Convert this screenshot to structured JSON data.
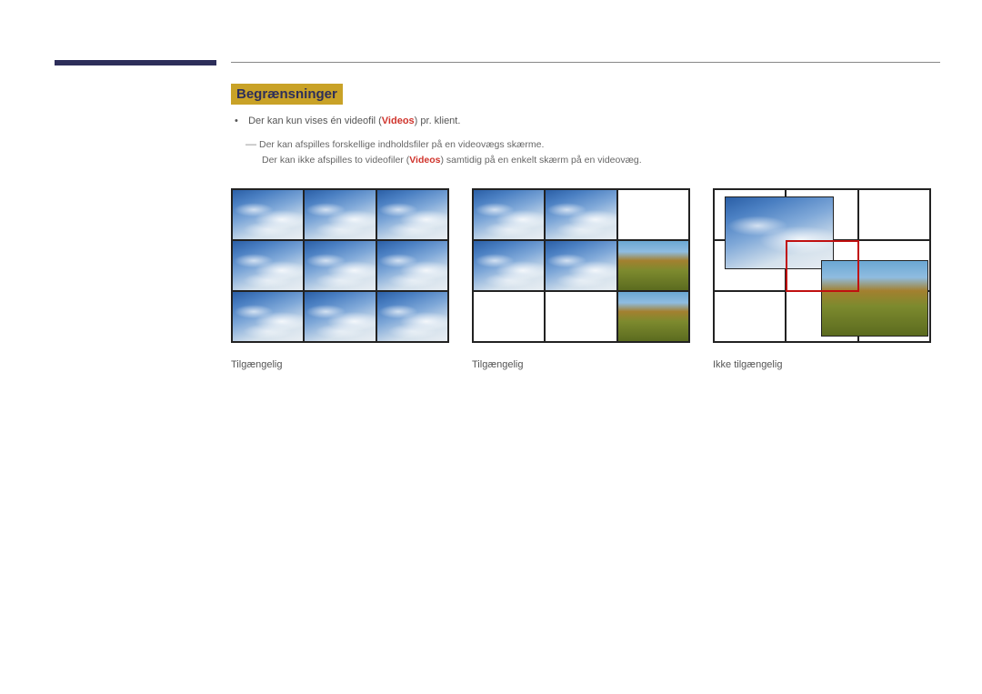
{
  "section_heading": "Begrænsninger",
  "bullet": {
    "text_before": "Der kan kun vises én videofil (",
    "videos_word": "Videos",
    "text_after": ") pr. klient."
  },
  "sublines": {
    "line1": "Der kan afspilles forskellige indholdsfiler på en videovægs skærme.",
    "line2_before": "Der kan ikke afspilles to videofiler (",
    "line2_videos": "Videos",
    "line2_after": ") samtidig på en enkelt skærm på en videovæg."
  },
  "figures": [
    {
      "caption": "Tilgængelig"
    },
    {
      "caption": "Tilgængelig"
    },
    {
      "caption": "Ikke tilgængelig"
    }
  ]
}
